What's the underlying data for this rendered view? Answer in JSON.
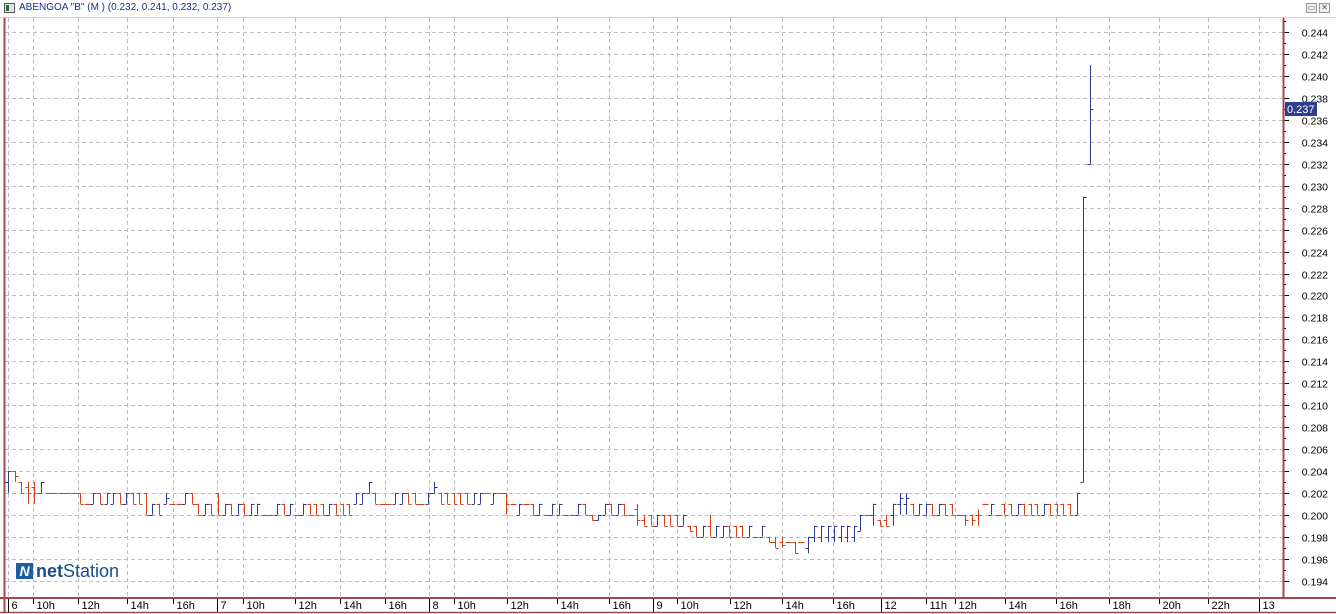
{
  "window": {
    "title": "ABENGOA \"B\" (M ) (0.232, 0.241, 0.232, 0.237)",
    "buttons": [
      "restore",
      "close"
    ]
  },
  "logo": {
    "mark": "N",
    "text_bold": "net",
    "text_regular": "Station"
  },
  "colors": {
    "up": "#2e3d8f",
    "down": "#d2401a",
    "axis": "#a04848",
    "grid": "#bdbdbd",
    "last_price_bg": "#2e3d8f"
  },
  "chart_data": {
    "type": "ohlc",
    "title": "ABENGOA \"B\" (M )",
    "last_price": "0.237",
    "ylim": [
      0.1925,
      0.2453
    ],
    "xlim": [
      -0.5,
      194.5
    ],
    "grid": true,
    "y_ticks": [
      "0.194",
      "0.196",
      "0.198",
      "0.200",
      "0.202",
      "0.204",
      "0.206",
      "0.208",
      "0.210",
      "0.212",
      "0.214",
      "0.216",
      "0.218",
      "0.220",
      "0.222",
      "0.224",
      "0.226",
      "0.228",
      "0.230",
      "0.232",
      "0.234",
      "0.236",
      "0.238",
      "0.240",
      "0.242",
      "0.244"
    ],
    "x_ticks": [
      {
        "label": "6",
        "at": 0.5,
        "day": true
      },
      {
        "label": "10h",
        "at": 4.7
      },
      {
        "label": "12h",
        "at": 11.6
      },
      {
        "label": "14h",
        "at": 19
      },
      {
        "label": "16h",
        "at": 26
      },
      {
        "label": "7",
        "at": 32.5,
        "day": true
      },
      {
        "label": "10h",
        "at": 36.7
      },
      {
        "label": "12h",
        "at": 44.7
      },
      {
        "label": "14h",
        "at": 51.6
      },
      {
        "label": "16h",
        "at": 58.4
      },
      {
        "label": "8",
        "at": 64.8,
        "day": true
      },
      {
        "label": "10h",
        "at": 69
      },
      {
        "label": "12h",
        "at": 77
      },
      {
        "label": "14h",
        "at": 84.6
      },
      {
        "label": "16h",
        "at": 92.5
      },
      {
        "label": "9",
        "at": 99,
        "day": true
      },
      {
        "label": "10h",
        "at": 103
      },
      {
        "label": "12h",
        "at": 111
      },
      {
        "label": "14h",
        "at": 119
      },
      {
        "label": "16h",
        "at": 126.7
      },
      {
        "label": "12",
        "at": 133.8,
        "day": true
      },
      {
        "label": "11h",
        "at": 141
      },
      {
        "label": "12h",
        "at": 145.3
      },
      {
        "label": "14h",
        "at": 153
      },
      {
        "label": "16h",
        "at": 160.8
      },
      {
        "label": "18h",
        "at": 168.9
      },
      {
        "label": "20h",
        "at": 176.5
      },
      {
        "label": "22h",
        "at": 184
      },
      {
        "label": "13",
        "at": 191.5,
        "day": true
      }
    ],
    "bars_format": [
      "open",
      "high",
      "low",
      "close"
    ],
    "bars": [
      [
        0.203,
        0.204,
        0.202,
        0.204
      ],
      [
        0.204,
        0.204,
        0.203,
        0.2035
      ],
      [
        0.203,
        0.203,
        0.202,
        0.202
      ],
      [
        0.2025,
        0.203,
        0.201,
        0.202
      ],
      [
        0.2025,
        0.203,
        0.201,
        0.202
      ],
      [
        0.202,
        0.203,
        0.202,
        0.203
      ],
      [
        0.202,
        0.202,
        0.202,
        0.202
      ],
      [
        0.202,
        0.202,
        0.202,
        0.202
      ],
      [
        0.202,
        0.202,
        0.202,
        0.202
      ],
      [
        0.202,
        0.202,
        0.202,
        0.202
      ],
      [
        0.202,
        0.202,
        0.202,
        0.202
      ],
      [
        0.202,
        0.202,
        0.201,
        0.201
      ],
      [
        0.201,
        0.201,
        0.201,
        0.201
      ],
      [
        0.201,
        0.202,
        0.201,
        0.202
      ],
      [
        0.202,
        0.202,
        0.201,
        0.201
      ],
      [
        0.201,
        0.202,
        0.201,
        0.202
      ],
      [
        0.201,
        0.202,
        0.201,
        0.202
      ],
      [
        0.202,
        0.202,
        0.201,
        0.201
      ],
      [
        0.201,
        0.202,
        0.201,
        0.202
      ],
      [
        0.202,
        0.202,
        0.201,
        0.201
      ],
      [
        0.202,
        0.202,
        0.201,
        0.201
      ],
      [
        0.202,
        0.202,
        0.2,
        0.2
      ],
      [
        0.2,
        0.201,
        0.2,
        0.201
      ],
      [
        0.201,
        0.201,
        0.2,
        0.2
      ],
      [
        0.201,
        0.202,
        0.201,
        0.2015
      ],
      [
        0.201,
        0.201,
        0.201,
        0.201
      ],
      [
        0.201,
        0.201,
        0.201,
        0.201
      ],
      [
        0.201,
        0.202,
        0.201,
        0.202
      ],
      [
        0.202,
        0.202,
        0.201,
        0.201
      ],
      [
        0.201,
        0.201,
        0.2,
        0.2
      ],
      [
        0.2,
        0.201,
        0.2,
        0.201
      ],
      [
        0.201,
        0.201,
        0.2,
        0.2
      ],
      [
        0.202,
        0.202,
        0.2,
        0.2
      ],
      [
        0.2,
        0.201,
        0.2,
        0.201
      ],
      [
        0.201,
        0.201,
        0.2,
        0.2
      ],
      [
        0.2,
        0.201,
        0.2,
        0.201
      ],
      [
        0.201,
        0.201,
        0.2,
        0.2
      ],
      [
        0.2,
        0.201,
        0.2,
        0.201
      ],
      [
        0.2,
        0.201,
        0.2,
        0.201
      ],
      [
        0.2,
        0.2,
        0.2,
        0.2
      ],
      [
        0.2,
        0.2,
        0.2,
        0.2
      ],
      [
        0.2,
        0.201,
        0.2,
        0.201
      ],
      [
        0.201,
        0.201,
        0.2,
        0.2
      ],
      [
        0.2,
        0.201,
        0.2,
        0.201
      ],
      [
        0.2,
        0.2,
        0.2,
        0.2
      ],
      [
        0.2,
        0.201,
        0.2,
        0.201
      ],
      [
        0.201,
        0.201,
        0.2,
        0.2
      ],
      [
        0.201,
        0.201,
        0.2,
        0.2
      ],
      [
        0.201,
        0.201,
        0.2,
        0.2
      ],
      [
        0.2,
        0.201,
        0.2,
        0.201
      ],
      [
        0.201,
        0.201,
        0.2,
        0.2
      ],
      [
        0.201,
        0.201,
        0.2,
        0.2
      ],
      [
        0.201,
        0.201,
        0.2,
        0.2
      ],
      [
        0.201,
        0.202,
        0.201,
        0.202
      ],
      [
        0.201,
        0.202,
        0.201,
        0.202
      ],
      [
        0.202,
        0.203,
        0.202,
        0.203
      ],
      [
        0.202,
        0.202,
        0.201,
        0.201
      ],
      [
        0.201,
        0.201,
        0.201,
        0.201
      ],
      [
        0.201,
        0.201,
        0.201,
        0.201
      ],
      [
        0.201,
        0.202,
        0.201,
        0.202
      ],
      [
        0.201,
        0.202,
        0.201,
        0.202
      ],
      [
        0.202,
        0.202,
        0.201,
        0.201
      ],
      [
        0.202,
        0.202,
        0.201,
        0.201
      ],
      [
        0.201,
        0.201,
        0.201,
        0.201
      ],
      [
        0.201,
        0.202,
        0.201,
        0.202
      ],
      [
        0.202,
        0.203,
        0.202,
        0.2025
      ],
      [
        0.202,
        0.202,
        0.201,
        0.201
      ],
      [
        0.202,
        0.202,
        0.201,
        0.201
      ],
      [
        0.202,
        0.202,
        0.201,
        0.201
      ],
      [
        0.202,
        0.202,
        0.201,
        0.201
      ],
      [
        0.202,
        0.202,
        0.201,
        0.201
      ],
      [
        0.201,
        0.202,
        0.201,
        0.202
      ],
      [
        0.201,
        0.202,
        0.201,
        0.202
      ],
      [
        0.202,
        0.202,
        0.202,
        0.202
      ],
      [
        0.201,
        0.202,
        0.201,
        0.202
      ],
      [
        0.202,
        0.202,
        0.202,
        0.202
      ],
      [
        0.202,
        0.202,
        0.2,
        0.201
      ],
      [
        0.201,
        0.201,
        0.201,
        0.201
      ],
      [
        0.2,
        0.201,
        0.2,
        0.201
      ],
      [
        0.201,
        0.201,
        0.201,
        0.201
      ],
      [
        0.201,
        0.201,
        0.2,
        0.2
      ],
      [
        0.2,
        0.201,
        0.2,
        0.201
      ],
      [
        0.2,
        0.2,
        0.2,
        0.2
      ],
      [
        0.2,
        0.201,
        0.2,
        0.201
      ],
      [
        0.2,
        0.201,
        0.2,
        0.201
      ],
      [
        0.2,
        0.2,
        0.2,
        0.2
      ],
      [
        0.2,
        0.2,
        0.2,
        0.2
      ],
      [
        0.2,
        0.201,
        0.2,
        0.201
      ],
      [
        0.201,
        0.201,
        0.2,
        0.2
      ],
      [
        0.2,
        0.2,
        0.1995,
        0.1995
      ],
      [
        0.1995,
        0.2,
        0.1995,
        0.2
      ],
      [
        0.2,
        0.201,
        0.2,
        0.201
      ],
      [
        0.201,
        0.201,
        0.2,
        0.2
      ],
      [
        0.2,
        0.201,
        0.2,
        0.201
      ],
      [
        0.201,
        0.201,
        0.2,
        0.2
      ],
      [
        0.2,
        0.2,
        0.2,
        0.2
      ],
      [
        0.2005,
        0.201,
        0.199,
        0.1995
      ],
      [
        0.1995,
        0.2,
        0.199,
        0.199
      ],
      [
        0.2,
        0.2,
        0.199,
        0.199
      ],
      [
        0.199,
        0.2,
        0.199,
        0.2
      ],
      [
        0.2,
        0.2,
        0.199,
        0.199
      ],
      [
        0.2,
        0.2,
        0.199,
        0.199
      ],
      [
        0.2,
        0.2,
        0.199,
        0.199
      ],
      [
        0.199,
        0.2,
        0.199,
        0.2
      ],
      [
        0.199,
        0.199,
        0.1985,
        0.1985
      ],
      [
        0.199,
        0.199,
        0.198,
        0.198
      ],
      [
        0.198,
        0.199,
        0.198,
        0.199
      ],
      [
        0.199,
        0.2,
        0.198,
        0.198
      ],
      [
        0.198,
        0.199,
        0.198,
        0.199
      ],
      [
        0.198,
        0.199,
        0.198,
        0.199
      ],
      [
        0.199,
        0.199,
        0.198,
        0.198
      ],
      [
        0.199,
        0.199,
        0.198,
        0.198
      ],
      [
        0.199,
        0.199,
        0.198,
        0.198
      ],
      [
        0.198,
        0.199,
        0.198,
        0.199
      ],
      [
        0.198,
        0.198,
        0.198,
        0.198
      ],
      [
        0.198,
        0.199,
        0.198,
        0.199
      ],
      [
        0.198,
        0.198,
        0.1975,
        0.1975
      ],
      [
        0.1975,
        0.198,
        0.197,
        0.197
      ],
      [
        0.1975,
        0.198,
        0.197,
        0.1972
      ],
      [
        0.1975,
        0.1975,
        0.1975,
        0.1975
      ],
      [
        0.1975,
        0.1975,
        0.1965,
        0.1965
      ],
      [
        0.1975,
        0.1975,
        0.1975,
        0.1975
      ],
      [
        0.197,
        0.198,
        0.1965,
        0.198
      ],
      [
        0.198,
        0.199,
        0.1975,
        0.199
      ],
      [
        0.198,
        0.199,
        0.1975,
        0.199
      ],
      [
        0.198,
        0.199,
        0.1975,
        0.199
      ],
      [
        0.198,
        0.199,
        0.1975,
        0.199
      ],
      [
        0.198,
        0.199,
        0.1975,
        0.199
      ],
      [
        0.198,
        0.199,
        0.1975,
        0.199
      ],
      [
        0.198,
        0.199,
        0.1975,
        0.199
      ],
      [
        0.1985,
        0.2,
        0.1985,
        0.2
      ],
      [
        0.2,
        0.2,
        0.2,
        0.2
      ],
      [
        0.2,
        0.201,
        0.199,
        0.201
      ],
      [
        0.1995,
        0.1995,
        0.199,
        0.199
      ],
      [
        0.1995,
        0.2,
        0.199,
        0.199
      ],
      [
        0.2,
        0.201,
        0.199,
        0.201
      ],
      [
        0.201,
        0.202,
        0.2,
        0.2015
      ],
      [
        0.201,
        0.202,
        0.2,
        0.2015
      ],
      [
        0.201,
        0.201,
        0.2,
        0.2
      ],
      [
        0.2,
        0.201,
        0.2,
        0.201
      ],
      [
        0.2,
        0.201,
        0.2,
        0.201
      ],
      [
        0.201,
        0.201,
        0.2,
        0.2
      ],
      [
        0.2,
        0.201,
        0.2,
        0.201
      ],
      [
        0.201,
        0.201,
        0.2,
        0.2
      ],
      [
        0.201,
        0.201,
        0.2,
        0.2
      ],
      [
        0.2,
        0.2,
        0.2,
        0.2
      ],
      [
        0.2,
        0.2,
        0.199,
        0.1995
      ],
      [
        0.2,
        0.2,
        0.199,
        0.1995
      ],
      [
        0.2,
        0.2005,
        0.199,
        0.2
      ],
      [
        0.201,
        0.201,
        0.201,
        0.201
      ],
      [
        0.2,
        0.201,
        0.2,
        0.201
      ],
      [
        0.2,
        0.2,
        0.2,
        0.2
      ],
      [
        0.201,
        0.201,
        0.2,
        0.2
      ],
      [
        0.201,
        0.201,
        0.2,
        0.2
      ],
      [
        0.2,
        0.201,
        0.2,
        0.201
      ],
      [
        0.201,
        0.201,
        0.2,
        0.2
      ],
      [
        0.201,
        0.201,
        0.2,
        0.2
      ],
      [
        0.201,
        0.201,
        0.2,
        0.2
      ],
      [
        0.2,
        0.201,
        0.2,
        0.201
      ],
      [
        0.201,
        0.201,
        0.2,
        0.2
      ],
      [
        0.201,
        0.201,
        0.2,
        0.2
      ],
      [
        0.201,
        0.201,
        0.2,
        0.2
      ],
      [
        0.201,
        0.201,
        0.2,
        0.2
      ],
      [
        0.2,
        0.202,
        0.2,
        0.202
      ],
      [
        0.203,
        0.229,
        0.203,
        0.229
      ],
      [
        0.232,
        0.241,
        0.232,
        0.237
      ]
    ]
  }
}
